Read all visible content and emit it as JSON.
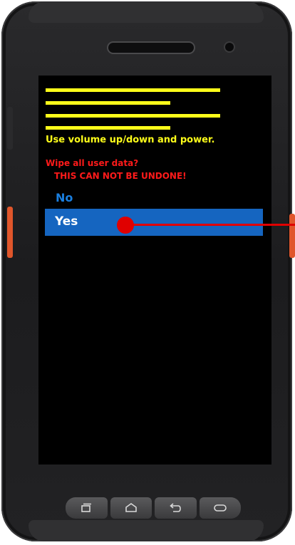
{
  "screen": {
    "instructions": "Use volume up/down and power.",
    "prompt": "Wipe all user data?",
    "warning": "THIS CAN NOT BE UNDONE!",
    "options": [
      {
        "label": "No",
        "selected": false
      },
      {
        "label": "Yes",
        "selected": true
      }
    ]
  },
  "nav": {
    "recent_icon": "recent-apps-icon",
    "home_icon": "home-icon",
    "back_icon": "back-icon",
    "menu_icon": "menu-icon"
  },
  "colors": {
    "instruction_text": "#ffff1a",
    "warning_text": "#ff1a1a",
    "option_text": "#1a7fe0",
    "selection_highlight": "#1565c0",
    "pointer": "#e00000"
  }
}
